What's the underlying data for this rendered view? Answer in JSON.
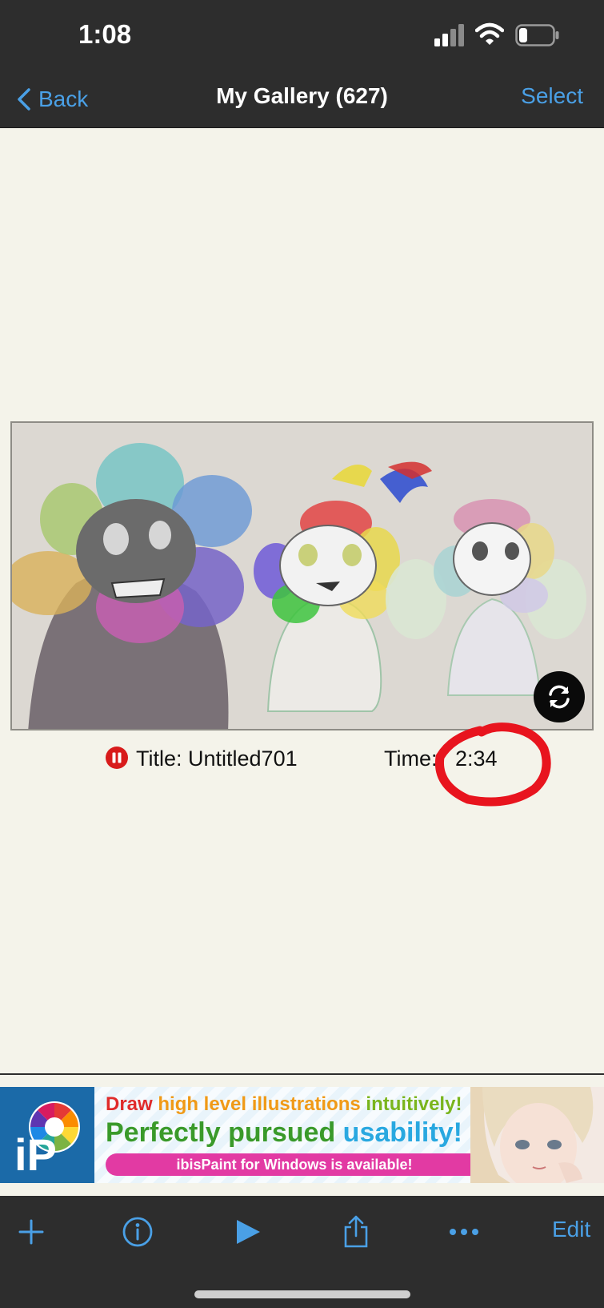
{
  "status_bar": {
    "time": "1:08",
    "signal_icon": "cellular-signal-icon",
    "wifi_icon": "wifi-icon",
    "battery_icon": "battery-icon",
    "battery_level": 0.25
  },
  "nav": {
    "back_label": "Back",
    "title": "My Gallery (627)",
    "select_label": "Select"
  },
  "artwork": {
    "rotate_icon": "rotate-icon"
  },
  "info": {
    "status_icon": "recording-paused-icon",
    "title_text": "Title: Untitled701",
    "time_label": "Time:",
    "time_value": "2:34"
  },
  "ad": {
    "line1_word1": "Draw",
    "line1_word2": "high level illustrations",
    "line1_word3": "intuitively!",
    "line2_word1": "Perfectly pursued",
    "line2_word2": "usability!",
    "pill_text": "ibisPaint for Windows is available!",
    "logo_text": "iP"
  },
  "toolbar": {
    "add_icon": "plus-icon",
    "info_icon": "info-icon",
    "play_icon": "play-icon",
    "share_icon": "share-icon",
    "more_icon": "more-icon",
    "edit_label": "Edit"
  },
  "colors": {
    "bar_background": "#2d2d2d",
    "accent": "#4aa0e6",
    "page_background": "#f4f3ea",
    "annotation": "#e8141e"
  }
}
